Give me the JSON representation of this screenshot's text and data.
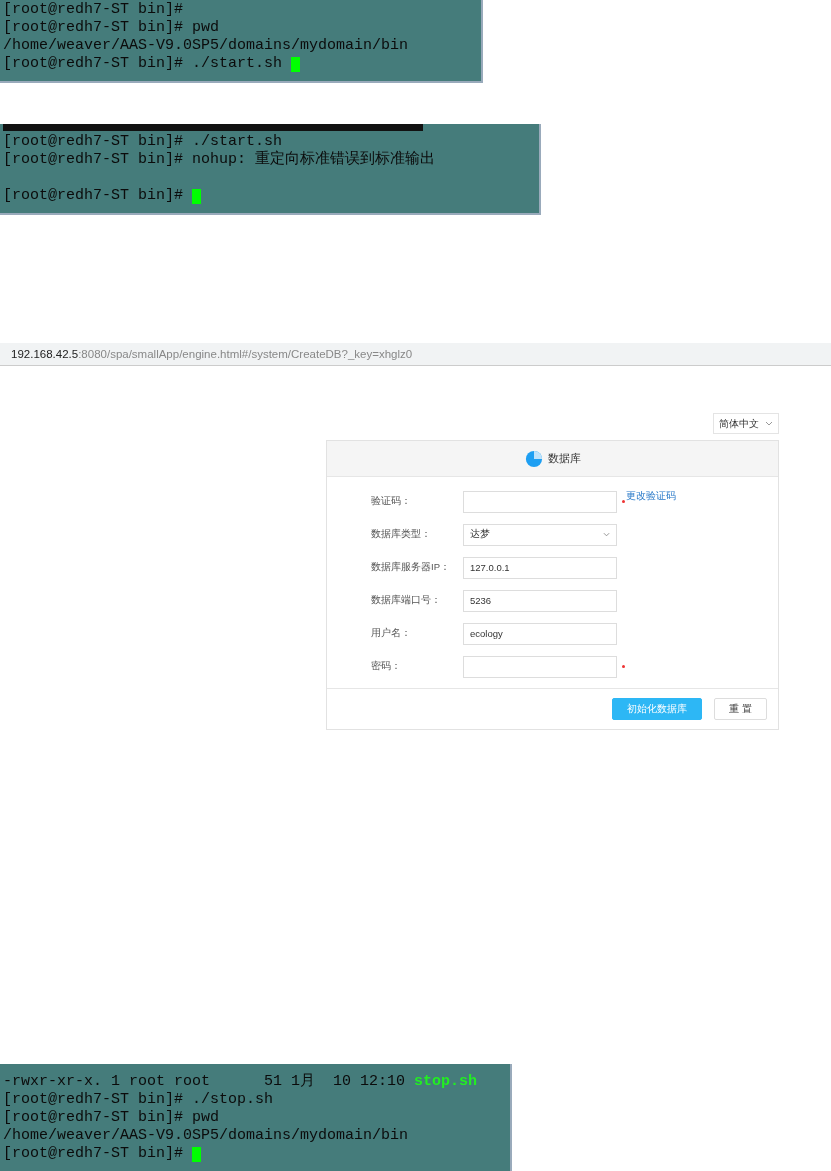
{
  "terminal_1": {
    "lines": [
      {
        "segments": [
          {
            "text": "[root@redh7-ST bin]#",
            "kind": "plain"
          }
        ],
        "cursor": false
      },
      {
        "segments": [
          {
            "text": "[root@redh7-ST bin]# pwd",
            "kind": "plain"
          }
        ],
        "cursor": false
      },
      {
        "segments": [
          {
            "text": "/home/weaver/AAS-V9.0SP5/domains/mydomain/bin",
            "kind": "plain"
          }
        ],
        "cursor": false
      },
      {
        "segments": [
          {
            "text": "[root@redh7-ST bin]# ./start.sh",
            "kind": "plain"
          }
        ],
        "cursor": true
      }
    ]
  },
  "terminal_2": {
    "lines": [
      {
        "segments": [
          {
            "text": "[root@redh7-ST bin]# ./start.sh",
            "kind": "plain"
          }
        ],
        "cursor": false
      },
      {
        "segments": [
          {
            "text": "[root@redh7-ST bin]# nohup: 重定向标准错误到标准输出",
            "kind": "plain"
          }
        ],
        "cursor": false
      },
      {
        "cursor": false
      },
      {
        "segments": [
          {
            "text": "[root@redh7-ST bin]#",
            "kind": "plain"
          }
        ],
        "cursor": true
      }
    ]
  },
  "browser": {
    "address_host": "192.168.42.5",
    "address_rest": ":8080/spa/smallApp/engine.html#/system/CreateDB?_key=xhglz0",
    "language": "简体中文",
    "card_title": "数据库",
    "fields": [
      {
        "label": "验证码：",
        "kind": "input",
        "required": true,
        "link": "更改验证码"
      },
      {
        "label": "数据库类型：",
        "kind": "select",
        "value": "达梦",
        "required": false
      },
      {
        "label": "数据库服务器IP：",
        "kind": "input",
        "value": "127.0.0.1",
        "required": false
      },
      {
        "label": "数据库端口号：",
        "kind": "input",
        "value": "5236",
        "required": false
      },
      {
        "label": "用户名：",
        "kind": "input",
        "value": "ecology",
        "required": false
      },
      {
        "label": "密码：",
        "kind": "input",
        "required": true
      }
    ],
    "buttons": [
      {
        "label": "初始化数据库",
        "kind": "primary"
      },
      {
        "label": "重 置",
        "kind": "default"
      }
    ]
  },
  "terminal_3": {
    "lines": [
      {
        "segments": [
          {
            "text": "-rwxr-xr-x. 1 root root      51 1月  10 12:10 ",
            "kind": "plain"
          },
          {
            "text": "stop.sh",
            "kind": "exec"
          }
        ],
        "cursor": false
      },
      {
        "segments": [
          {
            "text": "[root@redh7-ST bin]# ./stop.sh",
            "kind": "plain"
          }
        ],
        "cursor": false
      },
      {
        "segments": [
          {
            "text": "[root@redh7-ST bin]# pwd",
            "kind": "plain"
          }
        ],
        "cursor": false
      },
      {
        "segments": [
          {
            "text": "/home/weaver/AAS-V9.0SP5/domains/mydomain/bin",
            "kind": "plain"
          }
        ],
        "cursor": false
      },
      {
        "segments": [
          {
            "text": "[root@redh7-ST bin]#",
            "kind": "plain"
          }
        ],
        "cursor": true
      }
    ]
  }
}
